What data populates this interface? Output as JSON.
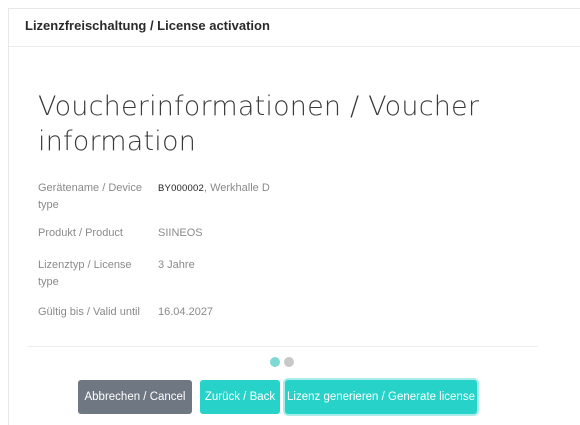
{
  "dialog": {
    "title": "Lizenzfreischaltung / License activation"
  },
  "section": {
    "title": "Voucherinformationen / Voucher information"
  },
  "fields": [
    {
      "label": "Gerätename / Device type",
      "code": "BY000002",
      "value": ", Werkhalle D"
    },
    {
      "label": "Produkt / Product",
      "value": "SIINEOS"
    },
    {
      "label": "Lizenztyp / License type",
      "value": "3 Jahre"
    },
    {
      "label": "Gültig bis / Valid until",
      "value": "16.04.2027"
    }
  ],
  "pager": {
    "total": 2,
    "active": 1
  },
  "buttons": {
    "cancel": "Abbrechen / Cancel",
    "back": "Zurück / Back",
    "generate": "Lizenz generieren / Generate license"
  },
  "colors": {
    "accent": "#27d3c8",
    "cancel": "#6f7782",
    "dot_active": "#7ed9d5",
    "dot_inactive": "#c8c8c8"
  }
}
